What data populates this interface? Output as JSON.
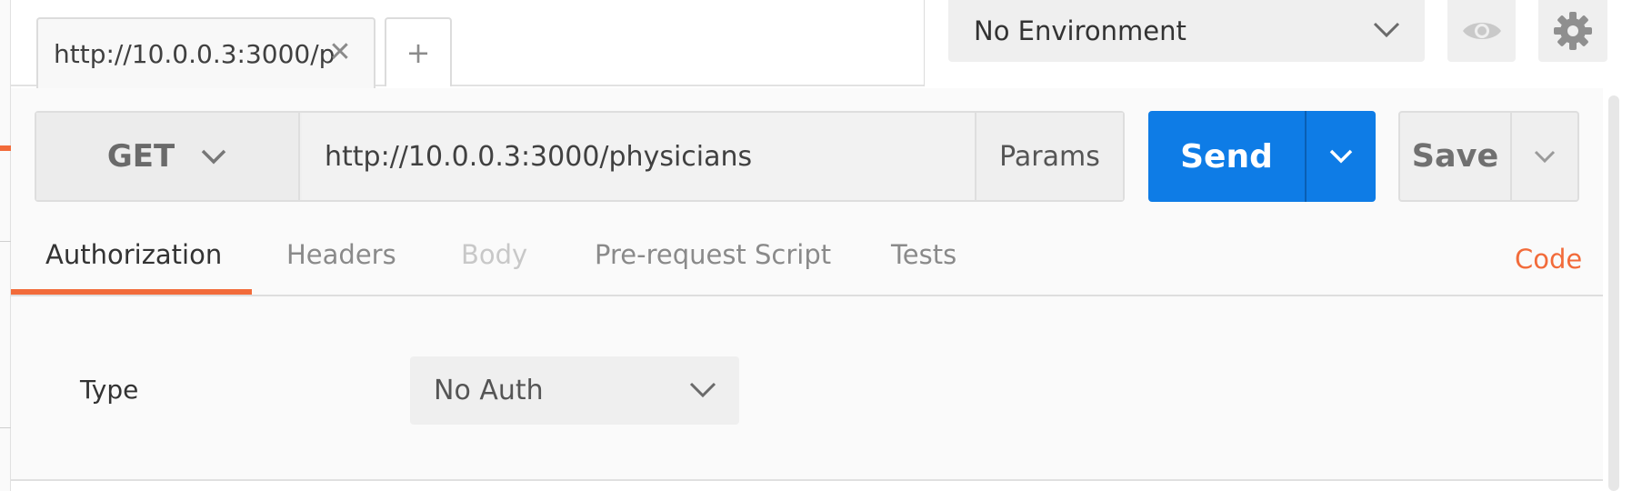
{
  "tabs": [
    {
      "label": "http://10.0.0.3:3000/p",
      "close_icon": "close-icon"
    }
  ],
  "new_tab": {
    "label": "+",
    "icon": "plus-icon"
  },
  "environment": {
    "selected": "No Environment",
    "icons": [
      "chevron-down-icon",
      "eye-icon",
      "gear-icon"
    ]
  },
  "request": {
    "method": "GET",
    "url": "http://10.0.0.3:3000/physicians",
    "params_label": "Params",
    "send_label": "Send",
    "save_label": "Save"
  },
  "subtabs": [
    {
      "label": "Authorization",
      "state": "active"
    },
    {
      "label": "Headers",
      "state": "normal"
    },
    {
      "label": "Body",
      "state": "disabled"
    },
    {
      "label": "Pre-request Script",
      "state": "normal"
    },
    {
      "label": "Tests",
      "state": "normal"
    }
  ],
  "code_label": "Code",
  "auth": {
    "type_label": "Type",
    "type_value": "No Auth"
  },
  "colors": {
    "accent_orange": "#f26b3a",
    "send_blue": "#0e7ce6",
    "control_gray": "#efefef",
    "panel_bg": "#fafafa"
  }
}
